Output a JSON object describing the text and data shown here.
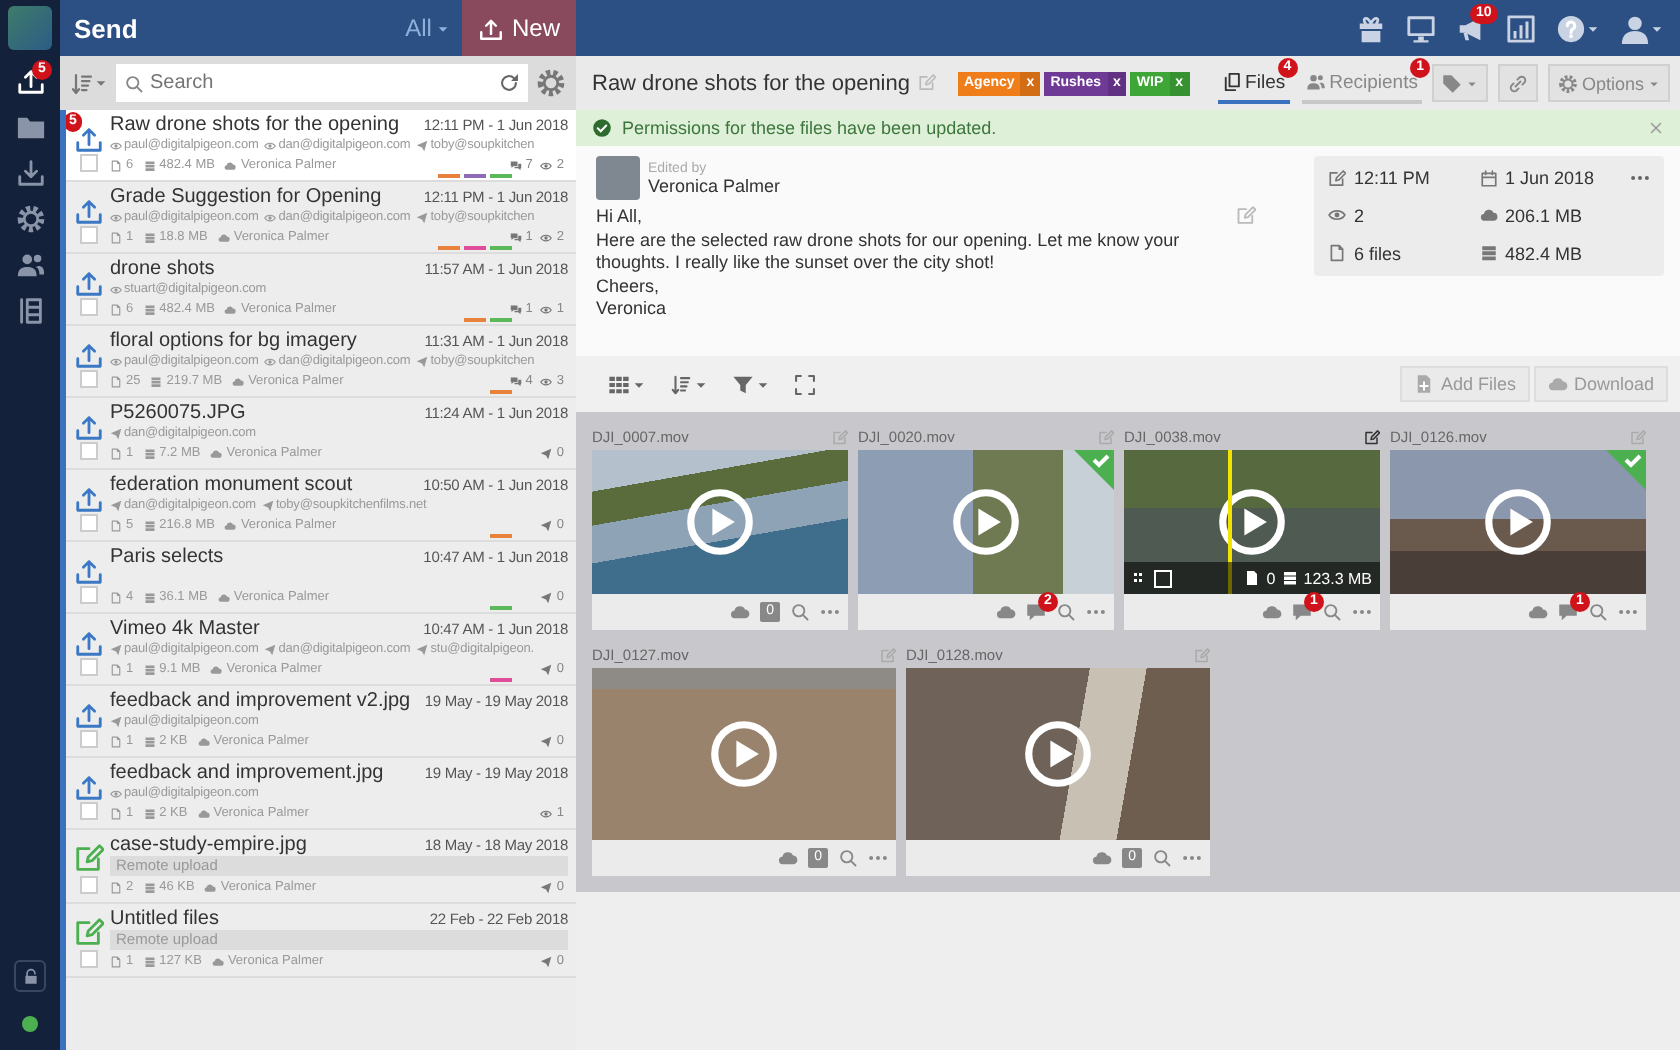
{
  "rail": {
    "items": [
      {
        "selected": true,
        "badge": "5"
      },
      {
        "selected": false
      },
      {
        "selected": false
      },
      {
        "selected": false
      },
      {
        "selected": false
      },
      {
        "selected": false
      }
    ]
  },
  "list_header": {
    "title": "Send",
    "filter": "All",
    "new_button": "New"
  },
  "search": {
    "placeholder": "Search"
  },
  "transfers": [
    {
      "kind": "upload",
      "title": "Raw drone shots for the opening",
      "time": "12:11 PM - 1 Jun 2018",
      "badge": "5",
      "selected": true,
      "checked": false,
      "recipients": [
        {
          "kind": "viewed",
          "email": "paul@digitalpigeon.com"
        },
        {
          "kind": "viewed",
          "email": "dan@digitalpigeon.com"
        },
        {
          "kind": "sent",
          "email": "toby@soupkitchen"
        }
      ],
      "files": "6",
      "size": "482.4 MB",
      "sender": "Veronica Palmer",
      "tags": [
        {
          "color": "#e8823a"
        },
        {
          "color": "#8e6bb5"
        },
        {
          "color": "#5cb85c"
        }
      ],
      "stats": [
        {
          "kind": "comments",
          "value": "7"
        },
        {
          "kind": "views",
          "value": "2"
        }
      ]
    },
    {
      "kind": "upload",
      "title": "Grade Suggestion for Opening",
      "time": "12:11 PM - 1 Jun 2018",
      "selected": false,
      "checked": false,
      "recipients": [
        {
          "kind": "viewed",
          "email": "paul@digitalpigeon.com"
        },
        {
          "kind": "viewed",
          "email": "dan@digitalpigeon.com"
        },
        {
          "kind": "sent",
          "email": "toby@soupkitchen"
        }
      ],
      "files": "1",
      "size": "18.8 MB",
      "sender": "Veronica Palmer",
      "tags": [
        {
          "color": "#e8823a"
        },
        {
          "color": "#e04e9a"
        },
        {
          "color": "#5cb85c"
        }
      ],
      "stats": [
        {
          "kind": "comments",
          "value": "1"
        },
        {
          "kind": "views",
          "value": "2"
        }
      ]
    },
    {
      "kind": "upload",
      "title": "drone shots",
      "time": "11:57 AM - 1 Jun 2018",
      "selected": false,
      "checked": false,
      "recipients": [
        {
          "kind": "viewed",
          "email": "stuart@digitalpigeon.com"
        }
      ],
      "files": "6",
      "size": "482.4 MB",
      "sender": "Veronica Palmer",
      "tags": [
        {
          "color": "#e8823a"
        },
        {
          "color": "#5cb85c"
        }
      ],
      "stats": [
        {
          "kind": "comments",
          "value": "1"
        },
        {
          "kind": "views",
          "value": "1"
        }
      ]
    },
    {
      "kind": "upload",
      "title": "floral options for bg imagery",
      "time": "11:31 AM - 1 Jun 2018",
      "selected": false,
      "checked": false,
      "recipients": [
        {
          "kind": "viewed",
          "email": "paul@digitalpigeon.com"
        },
        {
          "kind": "viewed",
          "email": "dan@digitalpigeon.com"
        },
        {
          "kind": "sent",
          "email": "toby@soupkitchen"
        }
      ],
      "files": "25",
      "size": "219.7 MB",
      "sender": "Veronica Palmer",
      "tags": [
        {
          "color": "#e8823a"
        }
      ],
      "stats": [
        {
          "kind": "comments",
          "value": "4"
        },
        {
          "kind": "views",
          "value": "3"
        }
      ]
    },
    {
      "kind": "upload",
      "title": "P5260075.JPG",
      "time": "11:24 AM - 1 Jun 2018",
      "selected": false,
      "checked": false,
      "recipients": [
        {
          "kind": "sent",
          "email": "dan@digitalpigeon.com"
        }
      ],
      "files": "1",
      "size": "7.2 MB",
      "sender": "Veronica Palmer",
      "stats": [
        {
          "kind": "sent",
          "value": "0"
        }
      ]
    },
    {
      "kind": "upload",
      "title": "federation monument scout",
      "time": "10:50 AM - 1 Jun 2018",
      "selected": false,
      "checked": false,
      "recipients": [
        {
          "kind": "sent",
          "email": "dan@digitalpigeon.com"
        },
        {
          "kind": "sent",
          "email": "toby@soupkitchenfilms.net"
        }
      ],
      "files": "5",
      "size": "216.8 MB",
      "sender": "Veronica Palmer",
      "tags": [
        {
          "color": "#e8823a"
        }
      ],
      "stats": [
        {
          "kind": "sent",
          "value": "0"
        }
      ]
    },
    {
      "kind": "upload",
      "title": "Paris selects",
      "time": "10:47 AM - 1 Jun 2018",
      "selected": false,
      "checked": false,
      "files": "4",
      "size": "36.1 MB",
      "sender": "Veronica Palmer",
      "tags": [
        {
          "color": "#5cb85c"
        }
      ],
      "stats": [
        {
          "kind": "sent",
          "value": "0"
        }
      ]
    },
    {
      "kind": "upload",
      "title": "Vimeo 4k Master",
      "time": "10:47 AM - 1 Jun 2018",
      "selected": false,
      "checked": false,
      "recipients": [
        {
          "kind": "sent",
          "email": "paul@digitalpigeon.com"
        },
        {
          "kind": "sent",
          "email": "dan@digitalpigeon.com"
        },
        {
          "kind": "sent",
          "email": "stu@digitalpigeon."
        }
      ],
      "files": "1",
      "size": "9.1 MB",
      "sender": "Veronica Palmer",
      "tags": [
        {
          "color": "#e04e9a"
        }
      ],
      "stats": [
        {
          "kind": "sent",
          "value": "0"
        }
      ]
    },
    {
      "kind": "upload",
      "title": "feedback and improvement v2.jpg",
      "time": "19 May - 19 May 2018",
      "selected": false,
      "checked": false,
      "recipients": [
        {
          "kind": "sent",
          "email": "paul@digitalpigeon.com"
        }
      ],
      "files": "1",
      "size": "2 KB",
      "sender": "Veronica Palmer",
      "stats": [
        {
          "kind": "sent",
          "value": "0"
        }
      ]
    },
    {
      "kind": "upload",
      "title": "feedback and improvement.jpg",
      "time": "19 May - 19 May 2018",
      "selected": false,
      "checked": false,
      "recipients": [
        {
          "kind": "viewed",
          "email": "paul@digitalpigeon.com"
        }
      ],
      "files": "1",
      "size": "2 KB",
      "sender": "Veronica Palmer",
      "stats": [
        {
          "kind": "views",
          "value": "1"
        }
      ]
    },
    {
      "kind": "remote",
      "title": "case-study-empire.jpg",
      "time": "18 May - 18 May 2018",
      "selected": false,
      "checked": false,
      "note": "Remote upload",
      "files": "2",
      "size": "46 KB",
      "sender": "Veronica Palmer",
      "stats": [
        {
          "kind": "sent",
          "value": "0"
        }
      ]
    },
    {
      "kind": "remote",
      "title": "Untitled files",
      "time": "22 Feb - 22 Feb 2018",
      "selected": false,
      "checked": false,
      "note": "Remote upload",
      "files": "1",
      "size": "127 KB",
      "sender": "Veronica Palmer",
      "stats": [
        {
          "kind": "sent",
          "value": "0"
        }
      ]
    }
  ],
  "top_bar": {
    "icons": [
      {
        "caret": false
      },
      {
        "caret": false
      },
      {
        "caret": false,
        "badge": "10"
      },
      {
        "caret": false
      },
      {
        "caret": true
      },
      {
        "caret": true
      }
    ]
  },
  "detail": {
    "title": "Raw drone shots for the opening",
    "tags": [
      {
        "label": "Agency",
        "remove": "x",
        "color": "#ef7d1a"
      },
      {
        "label": "Rushes",
        "remove": "x",
        "color": "#6f3a96"
      },
      {
        "label": "WIP",
        "remove": "x",
        "color": "#3ea537"
      }
    ],
    "tabs": [
      {
        "label": "Files",
        "badge": "4",
        "selected": true
      },
      {
        "label": "Recipients",
        "badge": "1",
        "selected": false
      }
    ],
    "options_button": "Options"
  },
  "notice": {
    "text": "Permissions for these files have been updated."
  },
  "message": {
    "edited_label": "Edited by",
    "editor": "Veronica Palmer",
    "body": [
      "Hi All,",
      "Here are the selected raw drone shots for our opening. Let me know your thoughts. I really like the sunset over the city shot!",
      "Cheers,",
      "Veronica"
    ]
  },
  "info": [
    {
      "text": "12:11 PM"
    },
    {
      "text": "1 Jun 2018"
    },
    {
      "text": "2"
    },
    {
      "text": "206.1 MB"
    },
    {
      "text": "6 files"
    },
    {
      "text": "482.4 MB"
    }
  ],
  "file_toolbar": {
    "add_button": "Add Files",
    "download_button": "Download"
  },
  "files": [
    {
      "name": "DJI_0007.mov",
      "approved": false,
      "comments": "0",
      "unread": false
    },
    {
      "name": "DJI_0020.mov",
      "approved": true,
      "comments": "2",
      "unread": true
    },
    {
      "name": "DJI_0038.mov",
      "approved": false,
      "comments": "1",
      "unread": true,
      "hover": {
        "checked": false,
        "files": "0",
        "size": "123.3 MB"
      }
    },
    {
      "name": "DJI_0126.mov",
      "approved": true,
      "comments": "1",
      "unread": true
    },
    {
      "name": "DJI_0127.mov",
      "approved": false,
      "comments": "0",
      "unread": false
    },
    {
      "name": "DJI_0128.mov",
      "approved": false,
      "comments": "0",
      "unread": false
    }
  ]
}
